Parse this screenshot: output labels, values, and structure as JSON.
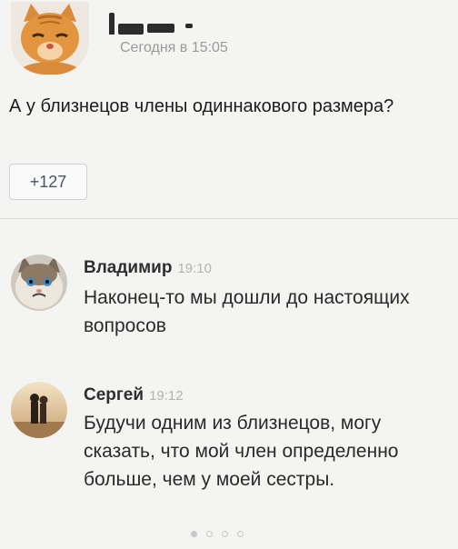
{
  "post": {
    "author_name": "",
    "timestamp": "Сегодня в 15:05",
    "text": "А у близнецов члены одиннакового размера?",
    "likes": "+127"
  },
  "comments": [
    {
      "author": "Владимир",
      "time": "19:10",
      "text": "Наконец-то мы дошли до настоящих вопросов"
    },
    {
      "author": "Сергей",
      "time": "19:12",
      "text": "Будучи одним из близнецов, могу сказать, что мой член определенно больше, чем у моей сестры."
    }
  ],
  "pager": {
    "label": "",
    "active_index": 0
  }
}
